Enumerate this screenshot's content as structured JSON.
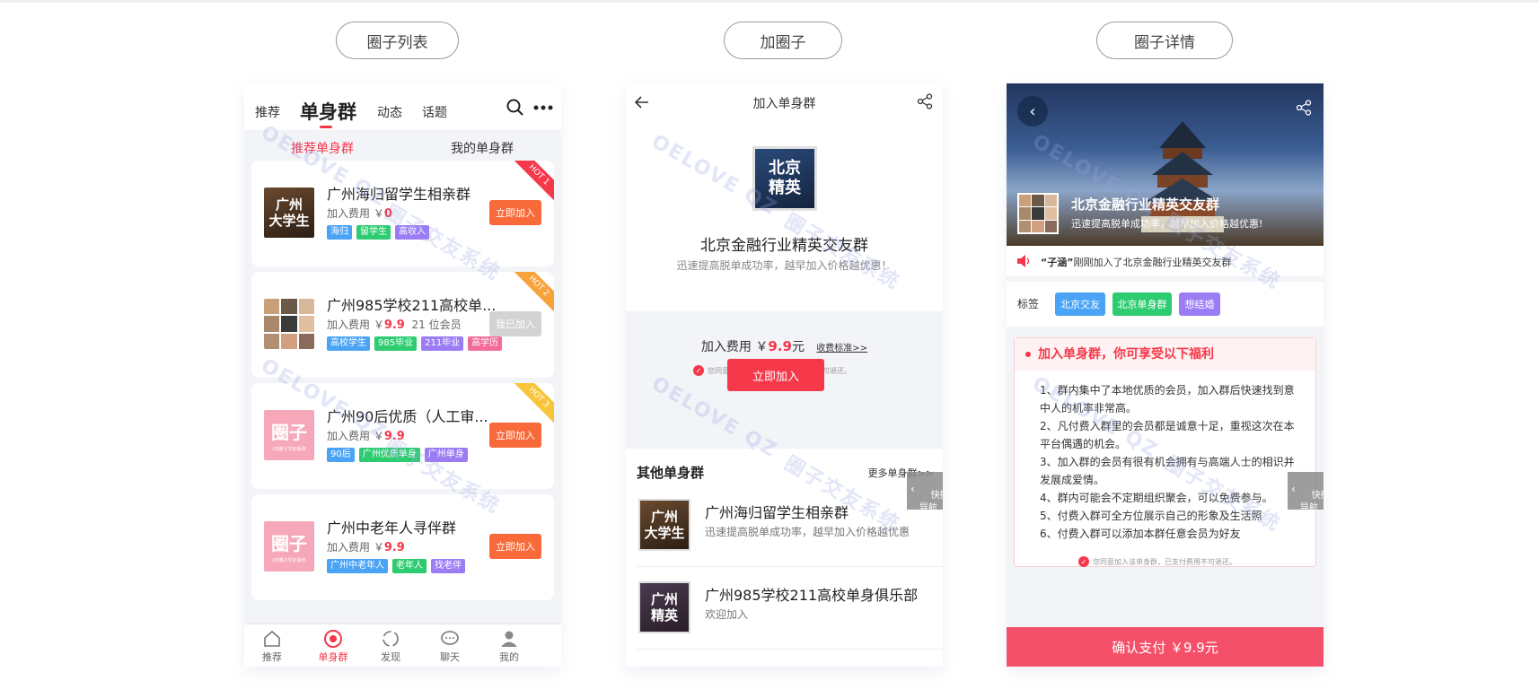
{
  "headings": {
    "list": "圈子列表",
    "join": "加圈子",
    "detail": "圈子详情"
  },
  "watermark": {
    "text1": "OELOVE QZ",
    "text2": "圈子交友系统"
  },
  "phone1": {
    "tabs": [
      "推荐",
      "单身群",
      "动态",
      "话题"
    ],
    "subtabs": [
      "推荐单身群",
      "我的单身群"
    ],
    "cards": [
      {
        "title": "广州海归留学生相亲群",
        "fee_label": "加入费用 ￥",
        "fee": "0",
        "extra": "",
        "button": "立即加入",
        "hot": "HOT 1",
        "thumb": "广州\n大学生",
        "tags": [
          "海归",
          "留学生",
          "高收入"
        ]
      },
      {
        "title": "广州985学校211高校单...",
        "fee_label": "加入费用 ￥",
        "fee": "9.9",
        "extra": "21 位会员",
        "button": "我已加入",
        "hot": "HOT 2",
        "thumb": "",
        "tags": [
          "高校学生",
          "985毕业",
          "211毕业",
          "高学历"
        ]
      },
      {
        "title": "广州90后优质（人工审...",
        "fee_label": "加入费用 ￥",
        "fee": "9.9",
        "extra": "",
        "button": "立即加入",
        "hot": "HOT 3",
        "thumb": "圈子",
        "tags": [
          "90后",
          "广州优质单身",
          "广州单身"
        ]
      },
      {
        "title": "广州中老年人寻伴群",
        "fee_label": "加入费用 ￥",
        "fee": "9.9",
        "extra": "",
        "button": "立即加入",
        "hot": "",
        "thumb": "圈子",
        "tags": [
          "广州中老年人",
          "老年人",
          "找老伴"
        ]
      }
    ],
    "nav": [
      "推荐",
      "单身群",
      "发现",
      "聊天",
      "我的"
    ]
  },
  "phone2": {
    "title": "加入单身群",
    "logo": "北京\n精英",
    "group_name": "北京金融行业精英交友群",
    "group_sub": "迅速提高脱单成功率，越早加入价格越优惠！",
    "fee_label": "加入费用 ￥",
    "fee": "9.9",
    "fee_unit": "元",
    "fee_link": "收费标准>>",
    "agree": "您同意加入该单身群，已支付费用不可退还。",
    "join_button": "立即加入",
    "other_title": "其他单身群",
    "other_more": "更多单身群>>",
    "others": [
      {
        "name": "广州海归留学生相亲群",
        "desc": "迅速提高脱单成功率，越早加入价格越优惠",
        "thumb": "广州\n大学生"
      },
      {
        "name": "广州985学校211高校单身俱乐部",
        "desc": "欢迎加入",
        "thumb": "广州\n精英"
      }
    ],
    "quick": "快捷\n导航"
  },
  "phone3": {
    "hero_title": "北京金融行业精英交友群",
    "hero_sub": "迅速提高脱单成功率，越早加入价格越优惠!",
    "notice_name": "“子涵”",
    "notice_text": "刚刚加入了北京金融行业精英交友群",
    "label_title": "标签",
    "labels": [
      "北京交友",
      "北京单身群",
      "想结婚"
    ],
    "benefit_title": "加入单身群，你可享受以下福利",
    "benefits": [
      "1、群内集中了本地优质的会员，加入群后快速找到意中人的机率非常高。",
      "2、凡付费入群里的会员都是诚意十足，重视这次在本平台偶遇的机会。",
      "3、加入群的会员有很有机会拥有与高端人士的相识并发展成爱情。",
      "4、群内可能会不定期组织聚会，可以免费参与。",
      "5、付费入群可全方位展示自己的形象及生活照",
      "6、付费入群可以添加本群任意会员为好友"
    ],
    "agree": "您同意加入该单身群，已支付费用不可退还。",
    "pay_button": "确认支付 ￥9.9元",
    "quick": "快捷\n导航"
  },
  "colors": {
    "accent_red": "#f5384a",
    "join_orange": "#f86a3a",
    "tag_blue": "#4aa3f5",
    "tag_green": "#2ecc71",
    "tag_purple": "#9b7cf5",
    "tag_pink": "#f26b9b"
  }
}
